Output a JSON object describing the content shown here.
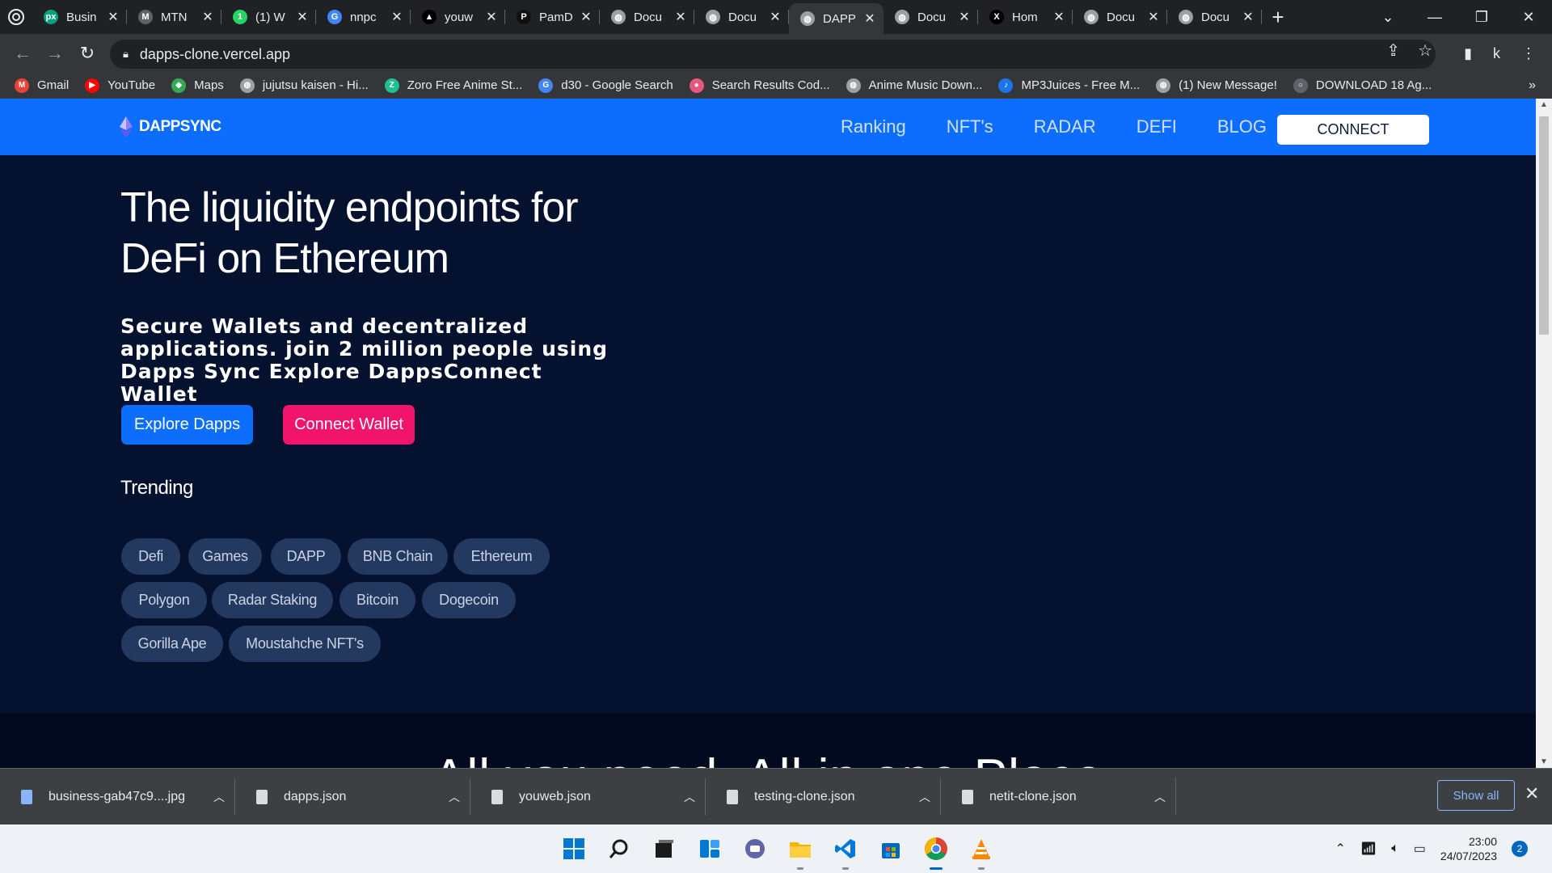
{
  "browser": {
    "tabs": [
      {
        "label": "Busin",
        "icon": "pexels-icon",
        "color": "#05a081",
        "glyph": "px"
      },
      {
        "label": "MTN",
        "icon": "mtn-icon",
        "color": "#5f6368",
        "glyph": "M"
      },
      {
        "label": "(1) W",
        "icon": "whatsapp-icon",
        "color": "#25d366",
        "glyph": "1"
      },
      {
        "label": "nnpc",
        "icon": "google-icon",
        "color": "#4285f4",
        "glyph": "G"
      },
      {
        "label": "youw",
        "icon": "vercel-icon",
        "color": "#000000",
        "glyph": "▲"
      },
      {
        "label": "PamD",
        "icon": "pamd-icon",
        "color": "#111111",
        "glyph": "P"
      },
      {
        "label": "Docu",
        "icon": "globe-icon",
        "color": "#9aa0a6",
        "glyph": "◍"
      },
      {
        "label": "Docu",
        "icon": "globe-icon",
        "color": "#9aa0a6",
        "glyph": "◍"
      },
      {
        "label": "DAPP",
        "icon": "globe-icon",
        "color": "#9aa0a6",
        "glyph": "◍",
        "active": true
      },
      {
        "label": "Docu",
        "icon": "globe-icon",
        "color": "#9aa0a6",
        "glyph": "◍"
      },
      {
        "label": "Hom",
        "icon": "x-icon",
        "color": "#000000",
        "glyph": "X"
      },
      {
        "label": "Docu",
        "icon": "globe-icon",
        "color": "#9aa0a6",
        "glyph": "◍"
      },
      {
        "label": "Docu",
        "icon": "globe-icon",
        "color": "#9aa0a6",
        "glyph": "◍"
      }
    ],
    "url": "dapps-clone.vercel.app",
    "profile_initial": "k",
    "bookmarks": [
      {
        "label": "Gmail",
        "icon": "gmail-icon",
        "color": "#ea4335",
        "glyph": "M"
      },
      {
        "label": "YouTube",
        "icon": "youtube-icon",
        "color": "#ff0000",
        "glyph": "▶"
      },
      {
        "label": "Maps",
        "icon": "maps-icon",
        "color": "#34a853",
        "glyph": "◆"
      },
      {
        "label": "jujutsu kaisen - Hi...",
        "icon": "globe-icon",
        "color": "#9aa0a6",
        "glyph": "◍"
      },
      {
        "label": "Zoro Free Anime St...",
        "icon": "zoro-icon",
        "color": "#1fbf8f",
        "glyph": "Z"
      },
      {
        "label": "d30 - Google Search",
        "icon": "google-icon",
        "color": "#4285f4",
        "glyph": "G"
      },
      {
        "label": "Search Results Cod...",
        "icon": "anime-icon",
        "color": "#e8577e",
        "glyph": "●"
      },
      {
        "label": "Anime Music Down...",
        "icon": "globe-icon",
        "color": "#9aa0a6",
        "glyph": "◍"
      },
      {
        "label": "MP3Juices - Free M...",
        "icon": "mp3juices-icon",
        "color": "#1a73e8",
        "glyph": "♪"
      },
      {
        "label": "(1) New Message!",
        "icon": "globe-icon",
        "color": "#9aa0a6",
        "glyph": "◍"
      },
      {
        "label": "DOWNLOAD 18 Ag...",
        "icon": "download-site-icon",
        "color": "#5f6368",
        "glyph": "○"
      }
    ]
  },
  "site": {
    "brand": "DAPPSYNC",
    "nav": [
      "Ranking",
      "NFT's",
      "RADAR",
      "DEFI",
      "BLOG"
    ],
    "connect": "CONNECT",
    "hero_title": "The liquidity endpoints for DeFi on Ethereum",
    "hero_subtitle": "Secure Wallets and decentralized applications. join 2 million people using Dapps Sync Explore DappsConnect Wallet",
    "explore_button": "Explore Dapps",
    "connect_wallet_button": "Connect Wallet",
    "trending_title": "Trending",
    "chips": [
      "Defi",
      "Games",
      "DAPP",
      "BNB Chain",
      "Ethereum",
      "Polygon",
      "Radar Staking",
      "Bitcoin",
      "Dogecoin",
      "Gorilla Ape",
      "Moustahche NFT's"
    ],
    "section2_title": "All you need, All in one Place",
    "colors": {
      "nav_blue": "#0d6efd",
      "page_bg": "#04122f",
      "accent_pink": "#f0146c",
      "chip_bg": "#24395f"
    }
  },
  "downloads": {
    "items": [
      "business-gab47c9....jpg",
      "dapps.json",
      "youweb.json",
      "testing-clone.json",
      "netit-clone.json"
    ],
    "show_all": "Show all"
  },
  "taskbar": {
    "time": "23:00",
    "date": "24/07/2023",
    "notifications": "2"
  }
}
